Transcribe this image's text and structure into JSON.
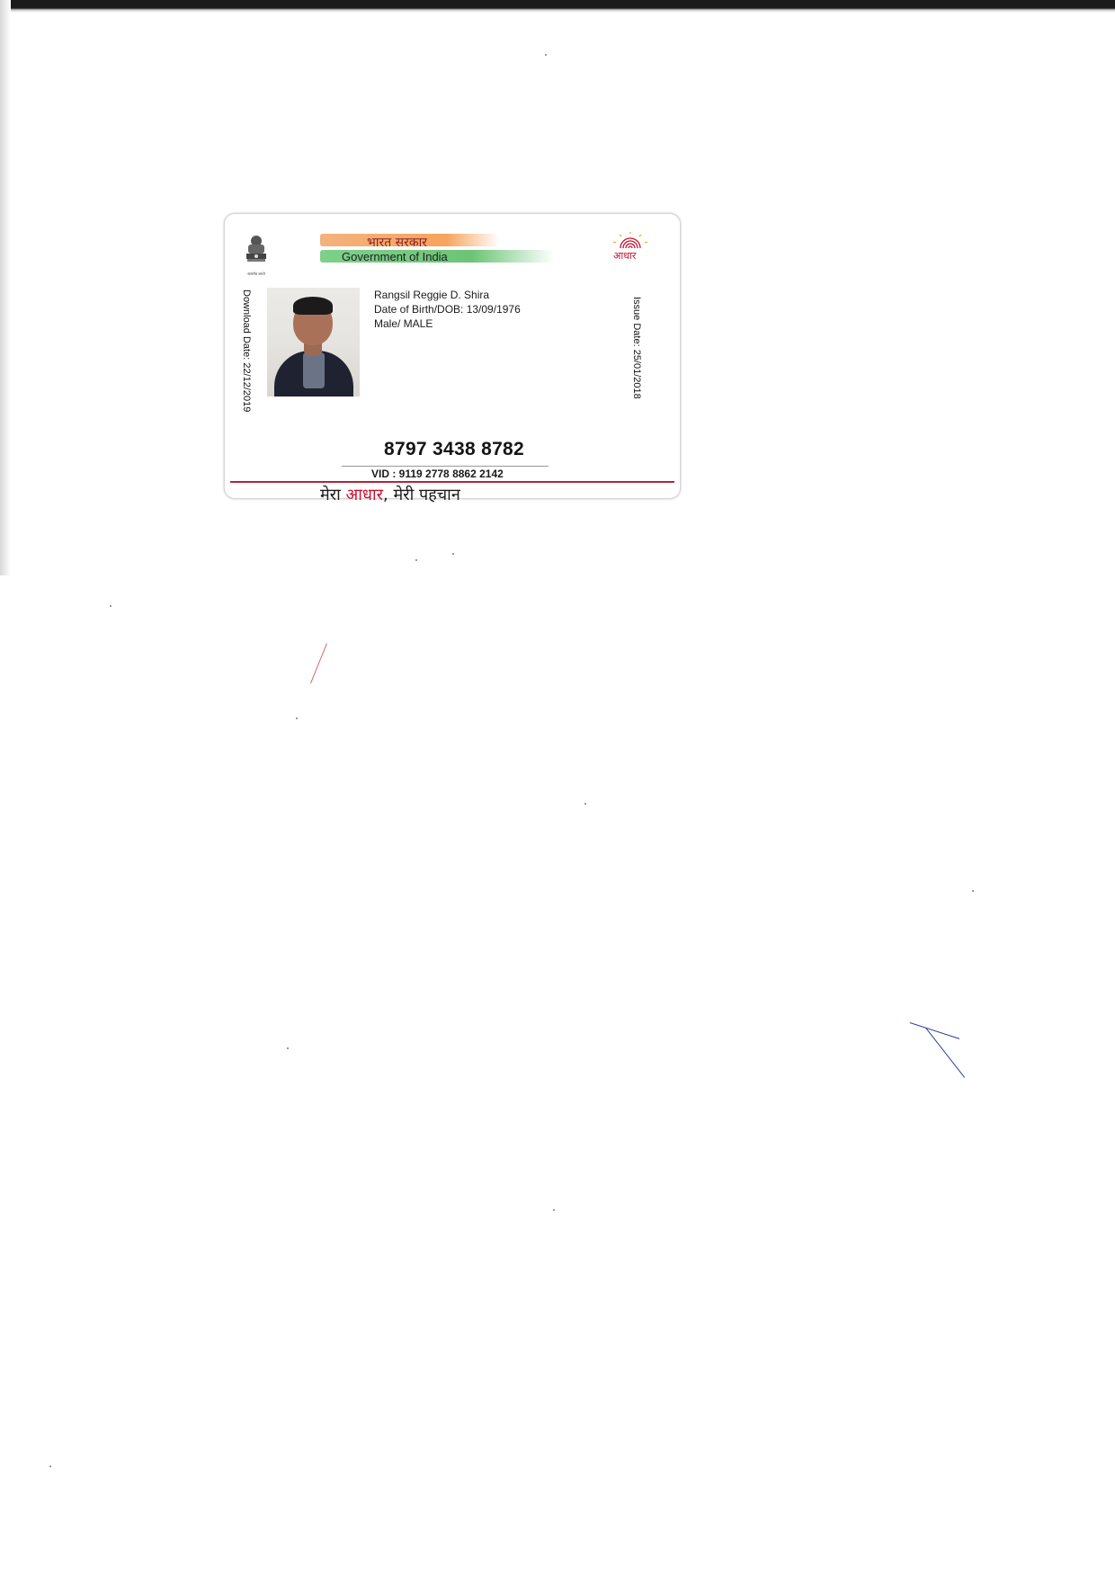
{
  "card": {
    "header_hindi": "भारत सरकार",
    "header_english": "Government of India",
    "logo_text": "आधार",
    "emblem_caption": "सत्यमेव जयते",
    "download_date": "Download Date: 22/12/2019",
    "issue_date": "Issue Date: 25/01/2018",
    "holder": {
      "name": "Rangsil Reggie D. Shira",
      "dob": "Date of Birth/DOB: 13/09/1976",
      "gender": "Male/ MALE"
    },
    "aadhaar_number": "8797 3438 8782",
    "vid": "VID : 9119 2778 8862 2142",
    "tagline_part1": "मेरा ",
    "tagline_accent": "आधार",
    "tagline_part2": ", मेरी पहचान"
  },
  "colors": {
    "saffron": "#f6a45e",
    "green": "#6cc476",
    "accent_red": "#c8102e"
  },
  "icons": [
    "national-emblem-icon",
    "aadhaar-fingerprint-sun-icon"
  ]
}
